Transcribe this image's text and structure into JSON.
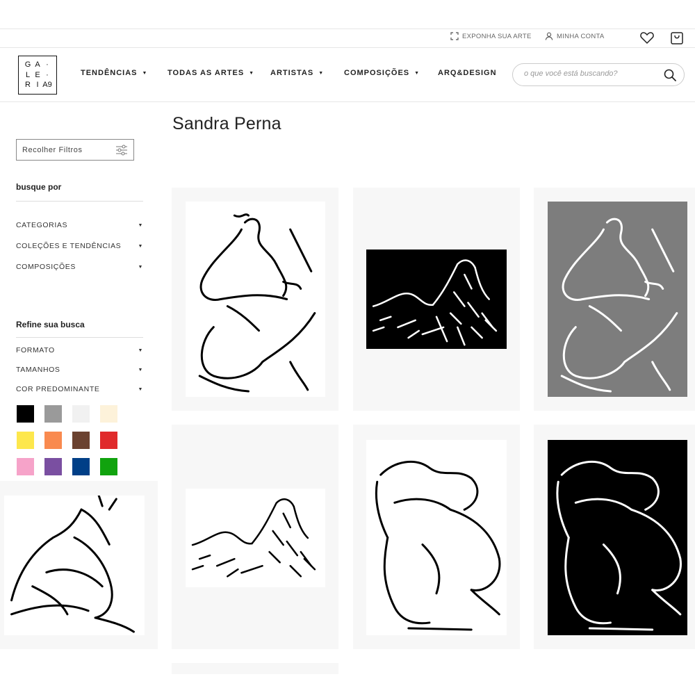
{
  "utility": {
    "expose_label": "EXPONHA SUA ARTE",
    "account_label": "MINHA CONTA"
  },
  "brand": {
    "logo_letters": [
      "G",
      "A",
      "·",
      "L",
      "E",
      "·",
      "R",
      "I",
      "A",
      "9"
    ]
  },
  "nav": {
    "items": [
      {
        "label": "TENDÊNCIAS",
        "has_caret": true
      },
      {
        "label": "TODAS AS ARTES",
        "has_caret": true
      },
      {
        "label": "ARTISTAS",
        "has_caret": true
      },
      {
        "label": "COMPOSIÇÕES",
        "has_caret": true
      },
      {
        "label": "ARQ&DESIGN",
        "has_caret": false
      }
    ]
  },
  "search": {
    "placeholder": "o que você está buscando?"
  },
  "page": {
    "title": "Sandra Perna"
  },
  "filters": {
    "toggle_label": "Recolher Filtros",
    "search_by_heading": "busque por",
    "search_by_items": [
      "CATEGORIAS",
      "COLEÇÕES E TENDÊNCIAS",
      "COMPOSIÇÕES"
    ],
    "refine_heading": "Refine sua busca",
    "refine_items": [
      "FORMATO",
      "TAMANHOS",
      "COR PREDOMINANTE"
    ],
    "colors": [
      "#000000",
      "#9a9a9a",
      "#f1f1f1",
      "#fdf2da",
      "#fde74c",
      "#f98a4f",
      "#6b4230",
      "#e02a2b",
      "#f6a3c9",
      "#7a4fa1",
      "#003f87",
      "#11a30e"
    ]
  },
  "products": [
    {
      "name": "artwork-1",
      "background": "#ffffff",
      "line": "#000000"
    },
    {
      "name": "artwork-2",
      "background": "#000000",
      "line": "#ffffff"
    },
    {
      "name": "artwork-3",
      "background": "#7d7d7d",
      "line": "#ffffff"
    },
    {
      "name": "artwork-4",
      "background": "#ffffff",
      "line": "#000000"
    },
    {
      "name": "artwork-5",
      "background": "#ffffff",
      "line": "#000000"
    },
    {
      "name": "artwork-6",
      "background": "#000000",
      "line": "#ffffff"
    },
    {
      "name": "artwork-7",
      "background": "#ffffff",
      "line": "#000000"
    }
  ]
}
